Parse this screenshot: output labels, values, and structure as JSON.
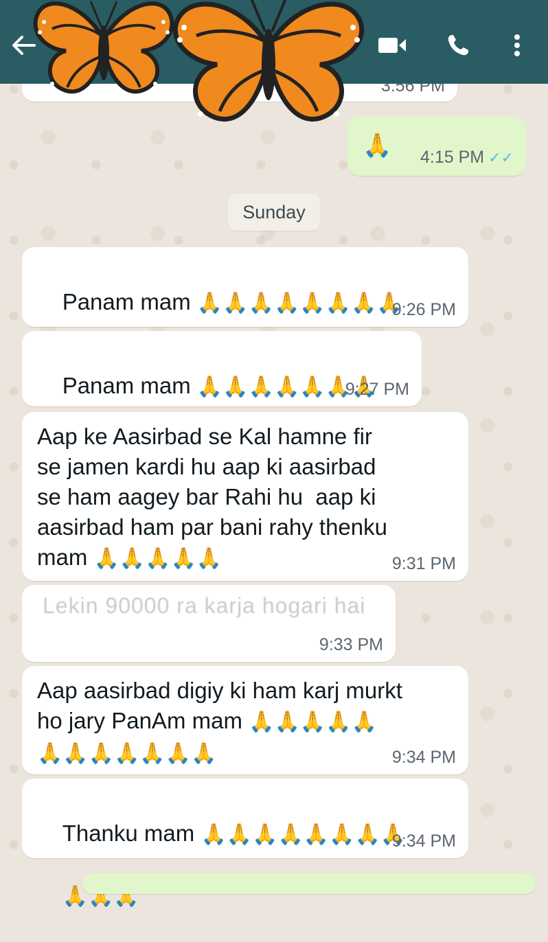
{
  "header": {
    "back_icon": "arrow-left-icon",
    "video_icon": "video-call-icon",
    "phone_icon": "phone-icon",
    "menu_icon": "more-vert-icon",
    "bg_color": "#2a5c63"
  },
  "stickers": [
    "butterfly",
    "butterfly"
  ],
  "messages": [
    {
      "kind": "in",
      "text": "",
      "time": "3:56 PM"
    },
    {
      "kind": "out",
      "text": "🙏",
      "time": "4:15 PM"
    },
    {
      "kind": "day",
      "text": "Sunday"
    },
    {
      "kind": "in",
      "line1": "Panam mam ",
      "emoji1": "🙏🙏🙏🙏🙏🙏🙏🙏",
      "emoji2": "🙏🌹🌹❤️❤️❤️",
      "time": "9:26 PM"
    },
    {
      "kind": "in",
      "line1": "Panam mam ",
      "emoji1": "🙏🙏🙏🙏🙏🙏🙏",
      "time": "9:27 PM"
    },
    {
      "kind": "in",
      "text": "Aap ke Aasirbad se Kal hamne fir\nse jamen kardi hu aap ki aasirbad\nse ham aagey bar Rahi hu  aap ki\naasirbad ham par bani rahy thenku\nmam ",
      "emoji1": "🙏🙏🙏🙏🙏",
      "time": "9:31 PM"
    },
    {
      "kind": "in",
      "text": "Lekin 90000 ra karja hogari hai",
      "time": "9:33 PM"
    },
    {
      "kind": "in",
      "text": "Aap aasirbad digiy ki ham karj murkt\nho jary PanAm mam ",
      "emoji1": "🙏🙏🙏🙏🙏",
      "emoji2": "🙏🙏🙏🙏🙏🙏🙏",
      "time": "9:34 PM"
    },
    {
      "kind": "in",
      "line1": "Thanku mam ",
      "emoji1": "🙏🙏🙏🙏🙏🙏🙏🙏",
      "emoji2": "🙏🙏🙏",
      "time": "9:34 PM"
    }
  ],
  "colors": {
    "incoming_bubble": "#ffffff",
    "outgoing_bubble": "#e1f7cb",
    "read_ticks": "#53bdeb"
  }
}
